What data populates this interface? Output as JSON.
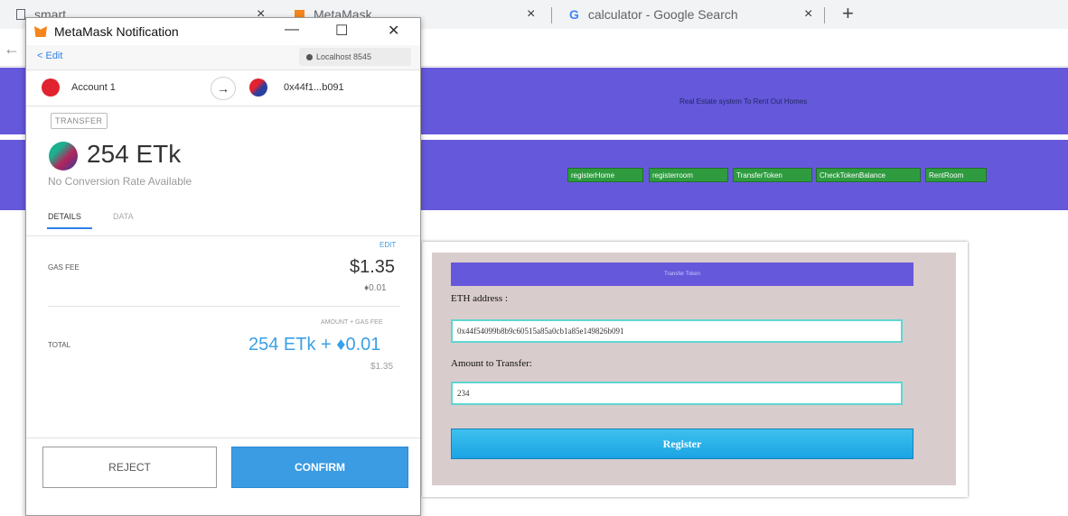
{
  "browser": {
    "tabs": [
      {
        "label": "smart"
      },
      {
        "label": "MetaMask"
      },
      {
        "label": "calculator - Google Search"
      }
    ],
    "close_glyph": "×",
    "new_tab_glyph": "+",
    "back_glyph": "←"
  },
  "page": {
    "header_title": "Real Estate system To Rent Out Homes",
    "nav": [
      {
        "label": "registerHome"
      },
      {
        "label": "registerroom"
      },
      {
        "label": "TransferToken"
      },
      {
        "label": "CheckTokenBalance"
      },
      {
        "label": "RentRoom"
      }
    ],
    "form": {
      "header": "Transfer Token",
      "eth_label": "ETH address :",
      "eth_value": "0x44f54099b8b9c60515a85a0cb1a85e149826b091",
      "amount_label": "Amount to Transfer:",
      "amount_value": "234",
      "submit_label": "Register"
    },
    "colors": {
      "header_bg": "#6658db",
      "nav_button": "#2e9b3f",
      "submit": "#1aa4e4"
    }
  },
  "metamask": {
    "title": "MetaMask Notification",
    "window_controls": {
      "minimize": "—",
      "maximize": "☐",
      "close": "✕"
    },
    "back_label": "< Edit",
    "network_label": "Localhost 8545",
    "network_icon": "circle-dot-icon",
    "from_account": "Account 1",
    "arrow_glyph": "→",
    "to_address": "0x44f1...b091",
    "type_badge": "TRANSFER",
    "amount": "254 ETk",
    "conversion_note": "No Conversion Rate Available",
    "tabs": {
      "details": "DETAILS",
      "data": "DATA"
    },
    "edit_link": "EDIT",
    "gas_fee_label": "GAS FEE",
    "gas_fee_usd": "$1.35",
    "gas_fee_eth": "♦0.01",
    "amount_plus_gas_label": "AMOUNT + GAS FEE",
    "total_label": "TOTAL",
    "total_value": "254 ETk + ♦0.01",
    "total_usd": "$1.35",
    "reject_label": "REJECT",
    "confirm_label": "CONFIRM",
    "colors": {
      "accent": "#3b9be3",
      "fox": "#f6851b"
    }
  }
}
